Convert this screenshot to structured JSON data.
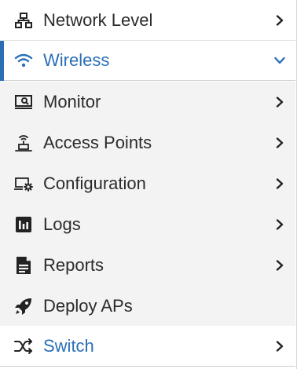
{
  "menu": {
    "network_level": {
      "label": "Network Level",
      "icon": "network-topology-icon"
    },
    "wireless": {
      "label": "Wireless",
      "icon": "wifi-icon",
      "expanded": true,
      "accent_color": "#2a6fb6"
    },
    "sub_items": [
      {
        "label": "Monitor",
        "icon": "monitor-icon"
      },
      {
        "label": "Access Points",
        "icon": "access-point-icon"
      },
      {
        "label": "Configuration",
        "icon": "configuration-icon"
      },
      {
        "label": "Logs",
        "icon": "logs-icon"
      },
      {
        "label": "Reports",
        "icon": "reports-icon"
      },
      {
        "label": "Deploy APs",
        "icon": "rocket-icon"
      }
    ],
    "switch": {
      "label": "Switch",
      "icon": "switch-icon"
    }
  }
}
